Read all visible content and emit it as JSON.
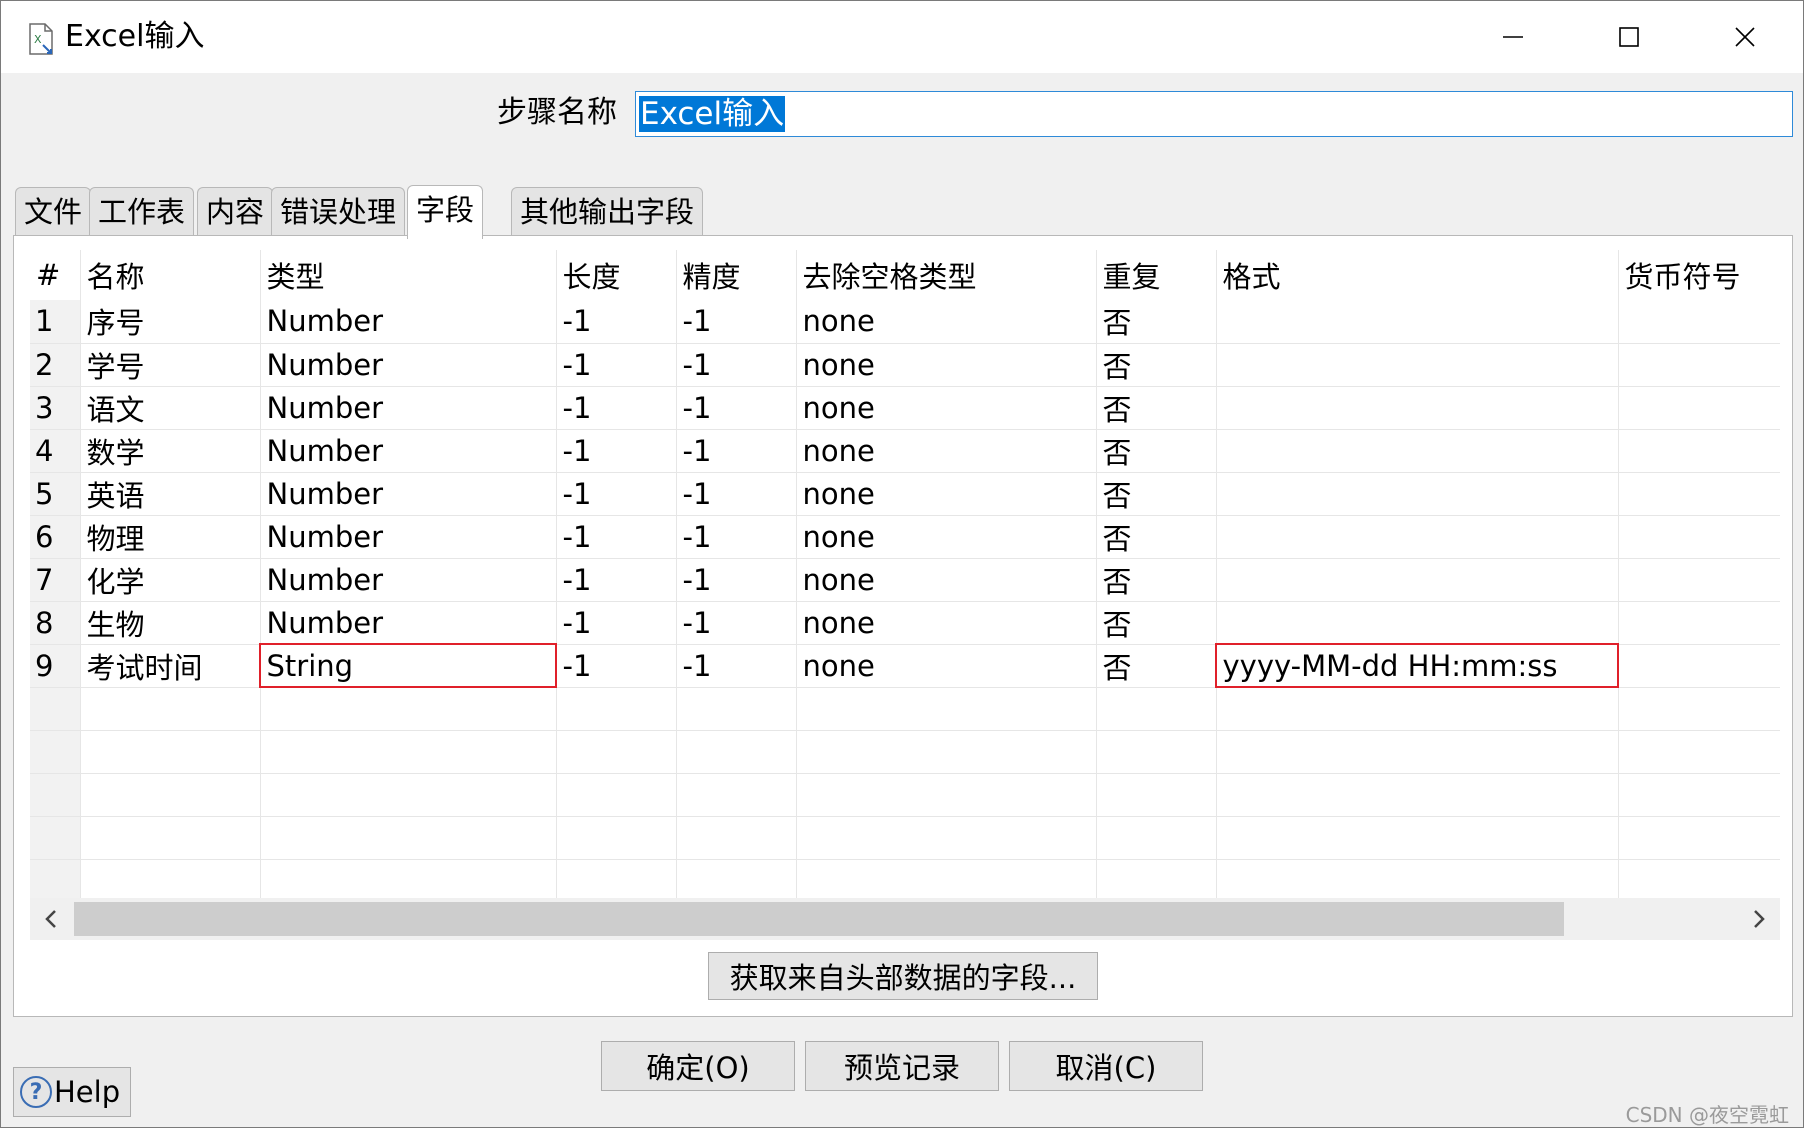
{
  "window": {
    "title": "Excel输入",
    "icon": "excel-file-icon",
    "minimize_icon": "minimize-icon",
    "maximize_icon": "maximize-icon",
    "close_icon": "close-icon"
  },
  "step": {
    "label": "步骤名称",
    "value": "Excel输入"
  },
  "tabs": [
    {
      "label": "文件"
    },
    {
      "label": "工作表"
    },
    {
      "label": "内容"
    },
    {
      "label": "错误处理"
    },
    {
      "label": "字段",
      "active": true
    },
    {
      "label": "其他输出字段"
    }
  ],
  "grid": {
    "headers": [
      "#",
      "名称",
      "类型",
      "长度",
      "精度",
      "去除空格类型",
      "重复",
      "格式",
      "货币符号"
    ],
    "rows": [
      {
        "idx": "1",
        "name": "序号",
        "type": "Number",
        "length": "-1",
        "precision": "-1",
        "trim": "none",
        "repeat": "否",
        "format": ""
      },
      {
        "idx": "2",
        "name": "学号",
        "type": "Number",
        "length": "-1",
        "precision": "-1",
        "trim": "none",
        "repeat": "否",
        "format": ""
      },
      {
        "idx": "3",
        "name": "语文",
        "type": "Number",
        "length": "-1",
        "precision": "-1",
        "trim": "none",
        "repeat": "否",
        "format": ""
      },
      {
        "idx": "4",
        "name": "数学",
        "type": "Number",
        "length": "-1",
        "precision": "-1",
        "trim": "none",
        "repeat": "否",
        "format": ""
      },
      {
        "idx": "5",
        "name": "英语",
        "type": "Number",
        "length": "-1",
        "precision": "-1",
        "trim": "none",
        "repeat": "否",
        "format": ""
      },
      {
        "idx": "6",
        "name": "物理",
        "type": "Number",
        "length": "-1",
        "precision": "-1",
        "trim": "none",
        "repeat": "否",
        "format": ""
      },
      {
        "idx": "7",
        "name": "化学",
        "type": "Number",
        "length": "-1",
        "precision": "-1",
        "trim": "none",
        "repeat": "否",
        "format": ""
      },
      {
        "idx": "8",
        "name": "生物",
        "type": "Number",
        "length": "-1",
        "precision": "-1",
        "trim": "none",
        "repeat": "否",
        "format": ""
      },
      {
        "idx": "9",
        "name": "考试时间",
        "type": "String",
        "length": "-1",
        "precision": "-1",
        "trim": "none",
        "repeat": "否",
        "format": "yyyy-MM-dd HH:mm:ss"
      }
    ],
    "highlight_color": "#e0202a"
  },
  "scrollbar": {
    "left_icon": "chevron-left-icon",
    "right_icon": "chevron-right-icon"
  },
  "buttons": {
    "get_fields": "获取来自头部数据的字段...",
    "ok": "确定(O)",
    "preview": "预览记录",
    "cancel": "取消(C)",
    "help": "Help",
    "help_icon": "question-circle-icon"
  },
  "watermark": "CSDN @夜空霓虹",
  "colors": {
    "selection": "#0078d7",
    "input_border": "#2e8ad8"
  }
}
